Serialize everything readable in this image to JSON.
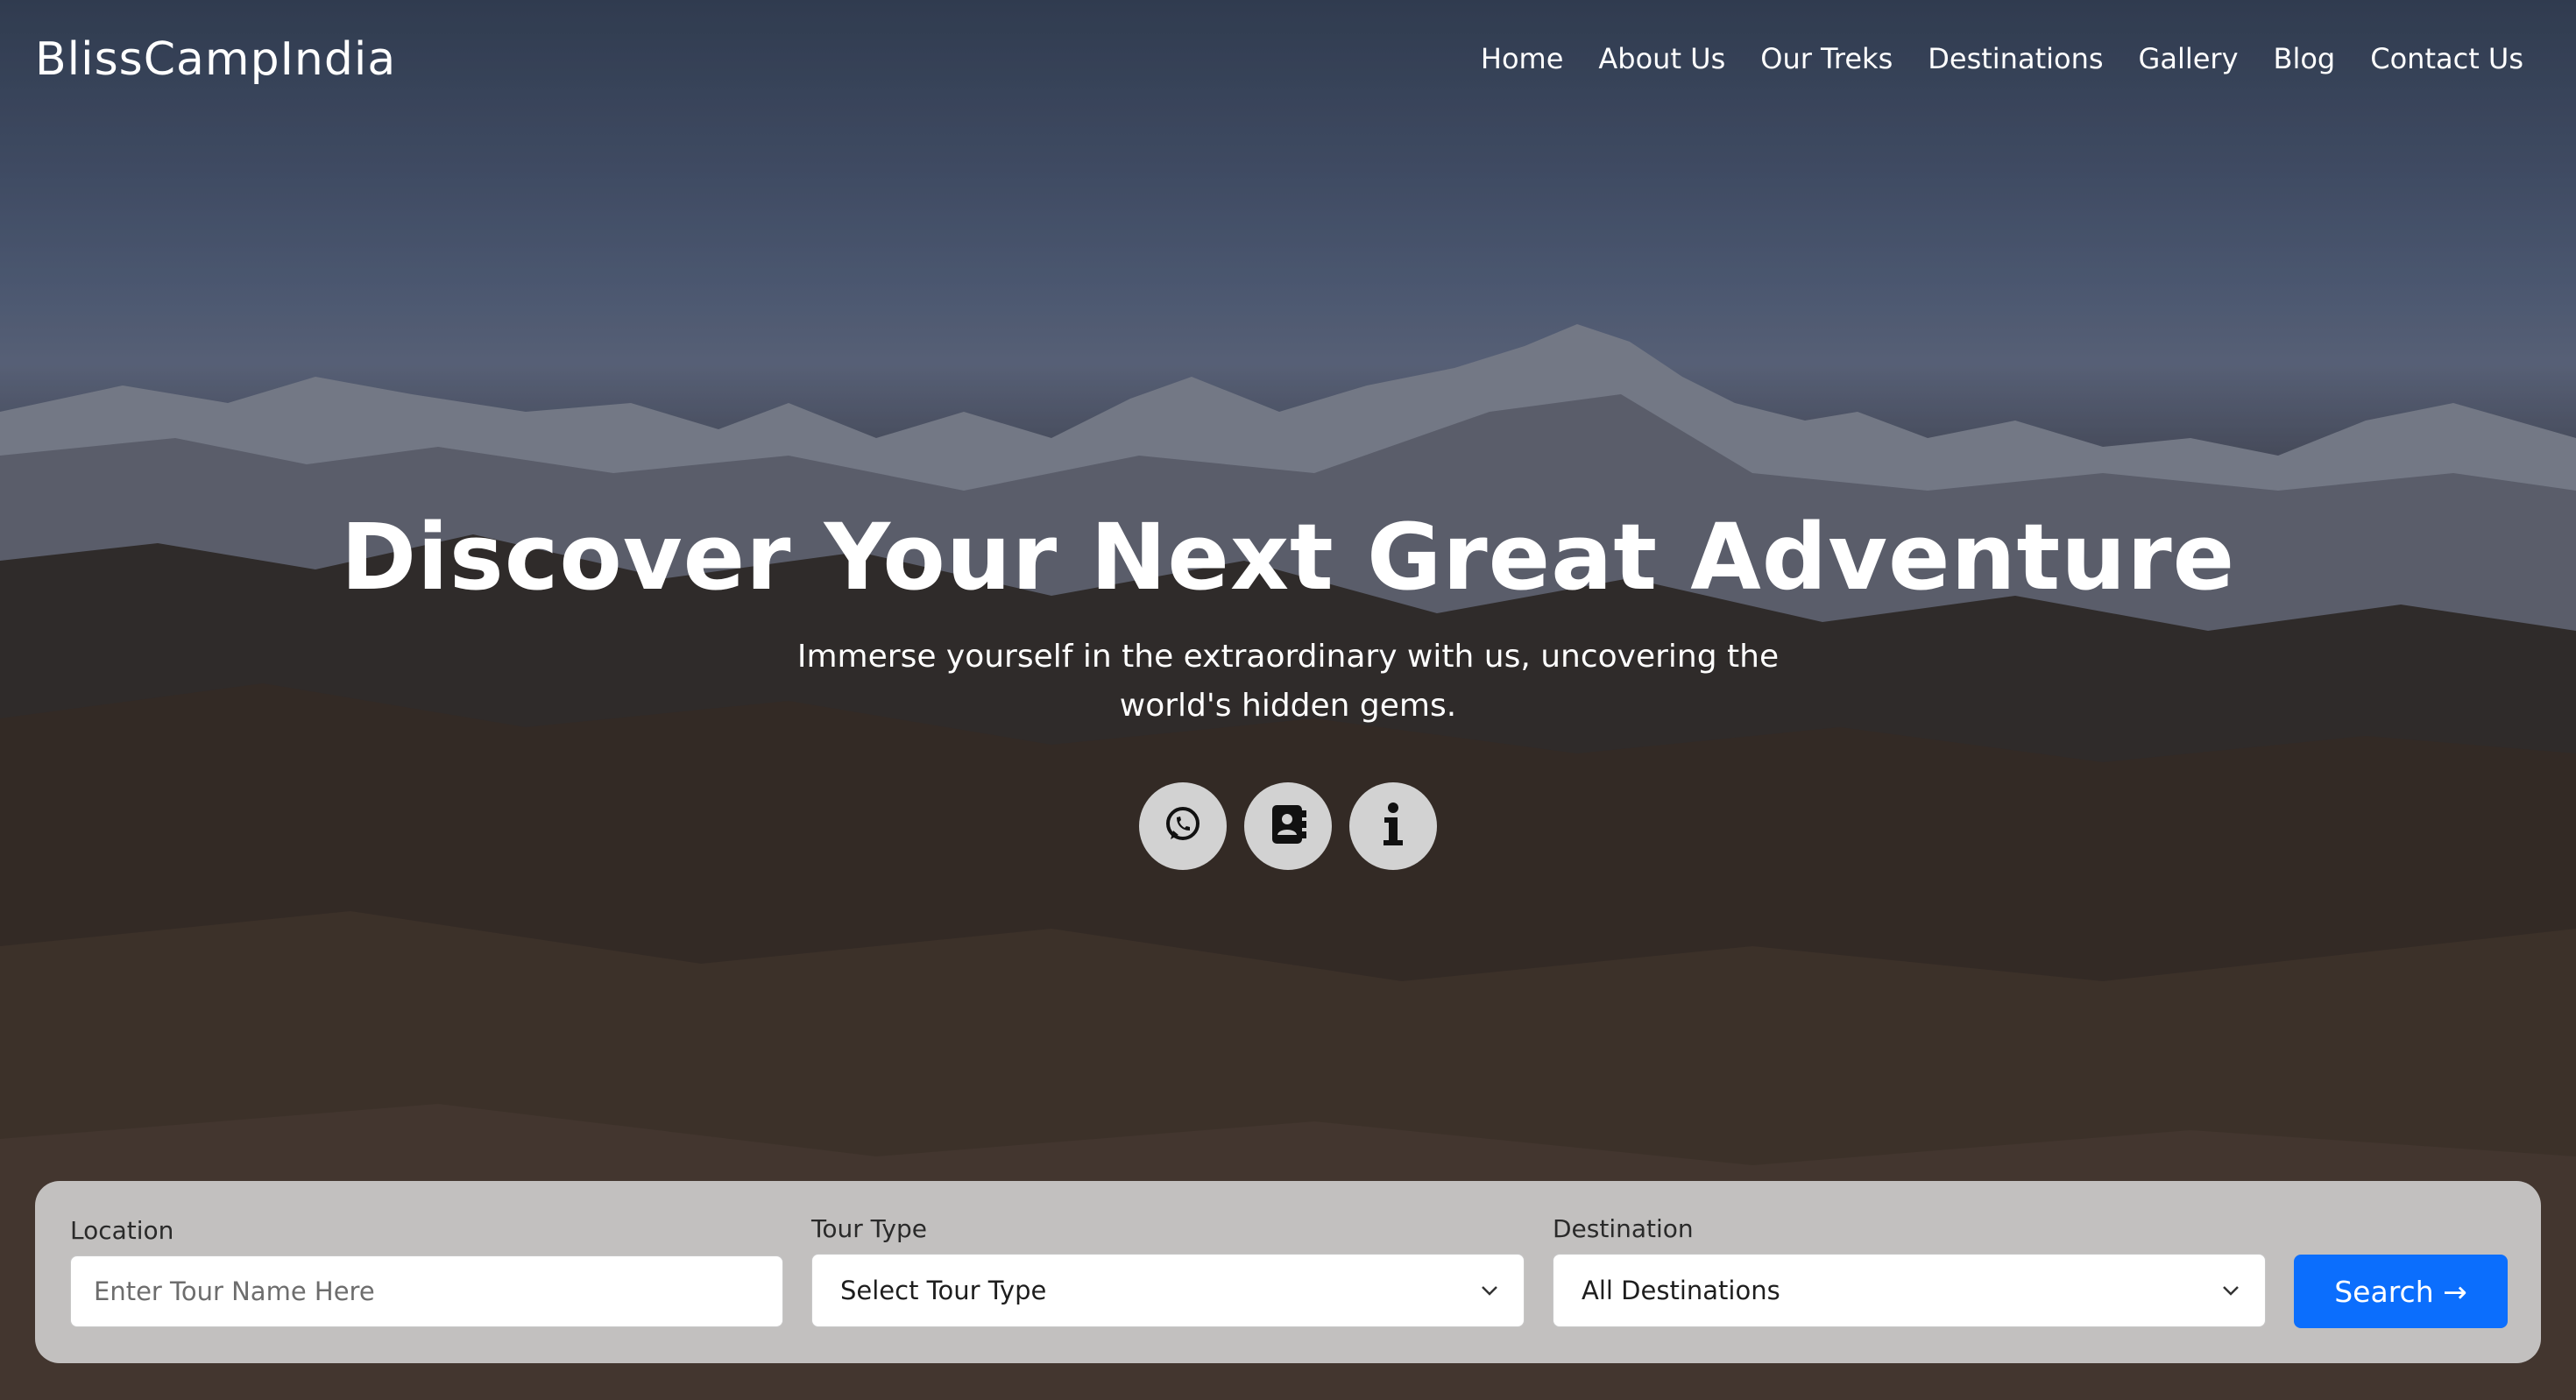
{
  "brand": "BlissCampIndia",
  "nav": {
    "home": "Home",
    "about": "About Us",
    "treks": "Our Treks",
    "destinations": "Destinations",
    "gallery": "Gallery",
    "blog": "Blog",
    "contact": "Contact Us"
  },
  "hero": {
    "title": "Discover Your Next Great Adventure",
    "subtitle": "Immerse yourself in the extraordinary with us, uncovering the world's hidden gems."
  },
  "icons": [
    "whatsapp-icon",
    "contact-book-icon",
    "info-icon"
  ],
  "search": {
    "location_label": "Location",
    "location_placeholder": "Enter Tour Name Here",
    "tour_type_label": "Tour Type",
    "tour_type_value": "Select Tour Type",
    "destination_label": "Destination",
    "destination_value": "All Destinations",
    "button_label": "Search →"
  },
  "colors": {
    "accent": "#0b6efd",
    "panel": "#d7d7d7",
    "text_light": "#ffffff"
  }
}
